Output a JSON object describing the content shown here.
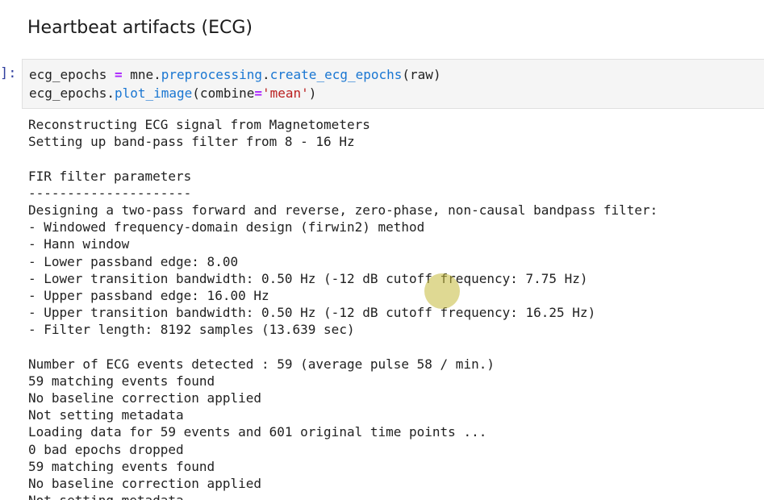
{
  "heading": "Heartbeat artifacts (ECG)",
  "cell": {
    "prompt": "]:",
    "code": {
      "line1": {
        "var": "ecg_epochs",
        "eq": " = ",
        "mod": "mne.",
        "attr1": "preprocessing",
        "dot": ".",
        "attr2": "create_ecg_epochs",
        "args": "(raw)"
      },
      "line2": {
        "var": "ecg_epochs.",
        "attr": "plot_image",
        "open": "(combine",
        "eq": "=",
        "str": "'mean'",
        "close": ")"
      }
    }
  },
  "output": {
    "lines": [
      "Reconstructing ECG signal from Magnetometers",
      "Setting up band-pass filter from 8 - 16 Hz",
      "",
      "FIR filter parameters",
      "---------------------",
      "Designing a two-pass forward and reverse, zero-phase, non-causal bandpass filter:",
      "- Windowed frequency-domain design (firwin2) method",
      "- Hann window",
      "- Lower passband edge: 8.00",
      "- Lower transition bandwidth: 0.50 Hz (-12 dB cutoff frequency: 7.75 Hz)",
      "- Upper passband edge: 16.00 Hz",
      "- Upper transition bandwidth: 0.50 Hz (-12 dB cutoff frequency: 16.25 Hz)",
      "- Filter length: 8192 samples (13.639 sec)",
      "",
      "Number of ECG events detected : 59 (average pulse 58 / min.)",
      "59 matching events found",
      "No baseline correction applied",
      "Not setting metadata",
      "Loading data for 59 events and 601 original time points ...",
      "0 bad epochs dropped",
      "59 matching events found",
      "No baseline correction applied",
      "Not setting metadata"
    ]
  },
  "colors": {
    "cell_background": "#f5f5f5",
    "prompt": "#303f9f",
    "attribute": "#1976d2",
    "string": "#ba2121",
    "operator": "#aa22ff",
    "cursor_highlight": "#c4ba3a"
  }
}
